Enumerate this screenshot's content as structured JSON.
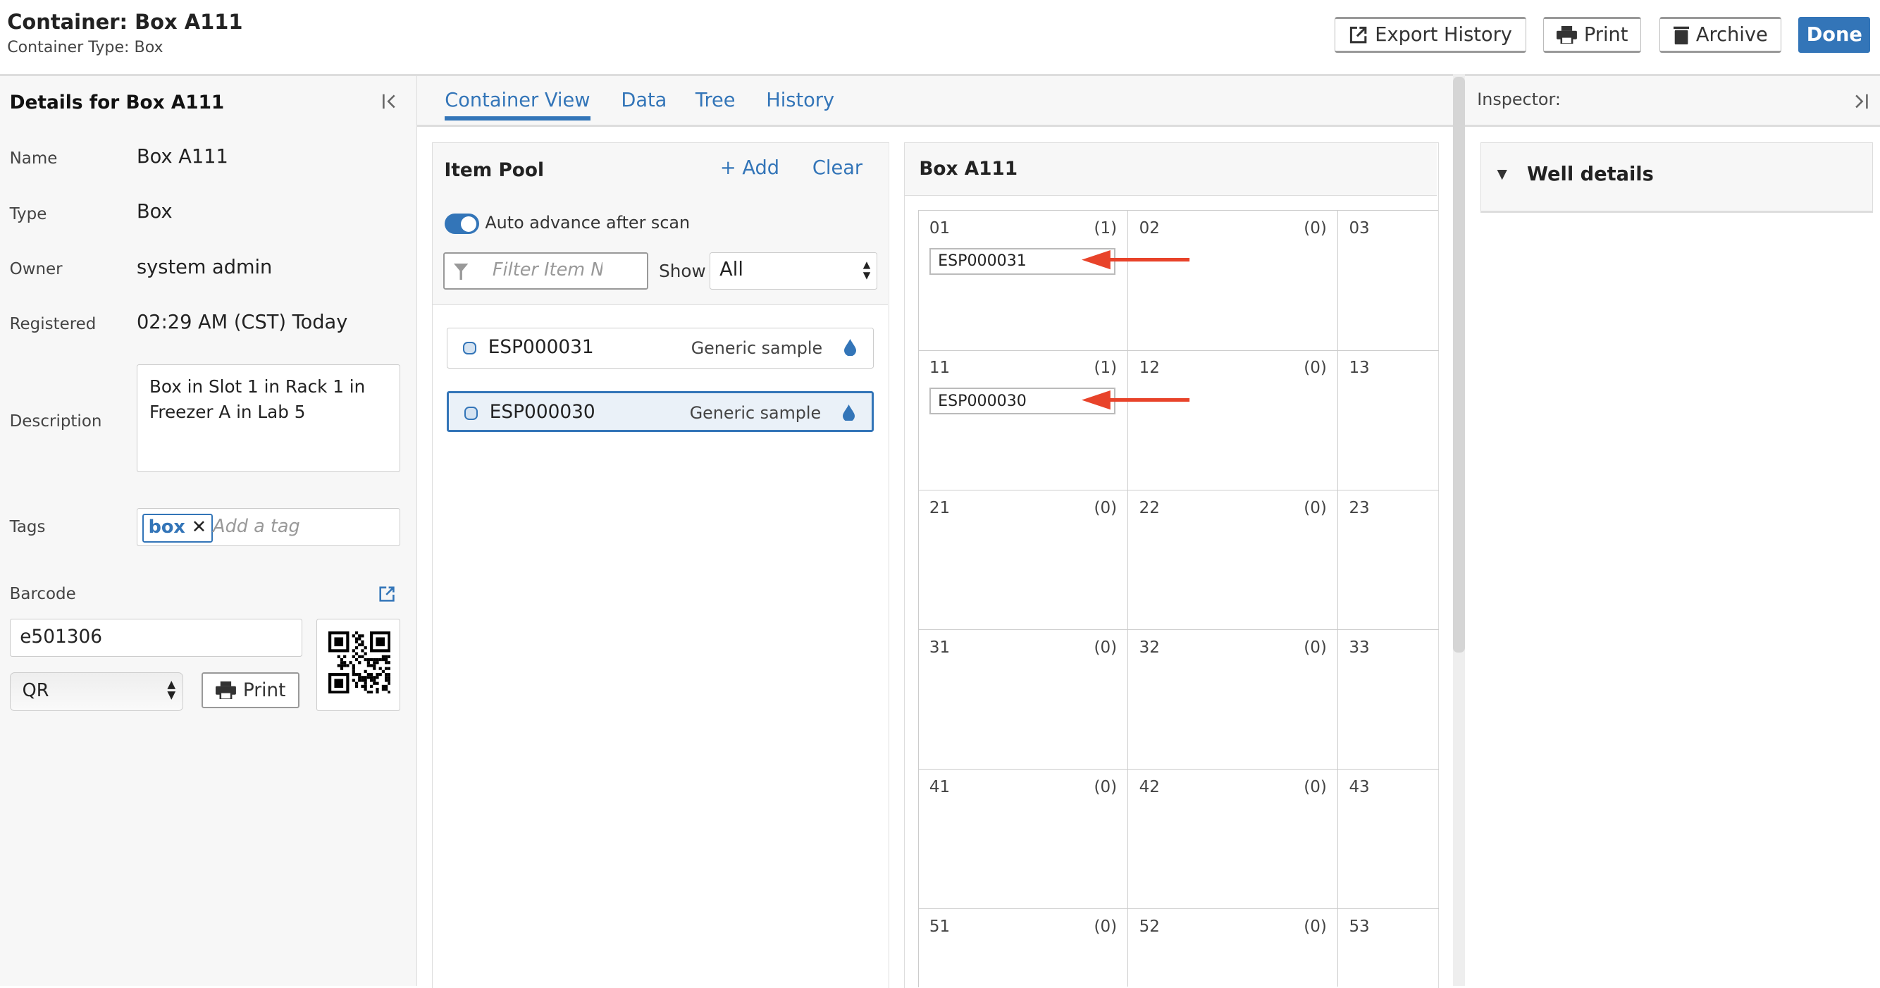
{
  "header": {
    "title": "Container: Box A111",
    "subtitle": "Container Type: Box",
    "buttons": {
      "export": "Export History",
      "print": "Print",
      "archive": "Archive",
      "done": "Done"
    }
  },
  "colors": {
    "accent": "#3375b8",
    "arrow": "#e8432a"
  },
  "details": {
    "title": "Details for Box A111",
    "fields": [
      {
        "label": "Name",
        "value": "Box A111"
      },
      {
        "label": "Type",
        "value": "Box"
      },
      {
        "label": "Owner",
        "value": "system admin"
      },
      {
        "label": "Registered",
        "value": "02:29 AM (CST) Today"
      }
    ],
    "description_label": "Description",
    "description": "Box in Slot 1 in Rack 1 in Freezer A in Lab 5",
    "tags_label": "Tags",
    "tag": "box",
    "tag_placeholder": "Add a tag",
    "barcode_label": "Barcode",
    "barcode": "e501306",
    "barcode_type": "QR",
    "print": "Print"
  },
  "tabs": [
    "Container View",
    "Data",
    "Tree",
    "History"
  ],
  "pool": {
    "title": "Item Pool",
    "add": "+ Add",
    "clear": "Clear",
    "auto_advance": "Auto advance after scan",
    "auto_advance_on": true,
    "filter_placeholder": "Filter Item Name",
    "show_label": "Show",
    "show_value": "All",
    "items": [
      {
        "id": "ESP000031",
        "type": "Generic sample",
        "selected": false
      },
      {
        "id": "ESP000030",
        "type": "Generic sample",
        "selected": true
      }
    ]
  },
  "box": {
    "title": "Box A111",
    "wells": [
      [
        {
          "label": "01",
          "count": "(1)",
          "item": "ESP000031"
        },
        {
          "label": "02",
          "count": "(0)"
        },
        {
          "label": "03"
        }
      ],
      [
        {
          "label": "11",
          "count": "(1)",
          "item": "ESP000030"
        },
        {
          "label": "12",
          "count": "(0)"
        },
        {
          "label": "13"
        }
      ],
      [
        {
          "label": "21",
          "count": "(0)"
        },
        {
          "label": "22",
          "count": "(0)"
        },
        {
          "label": "23"
        }
      ],
      [
        {
          "label": "31",
          "count": "(0)"
        },
        {
          "label": "32",
          "count": "(0)"
        },
        {
          "label": "33"
        }
      ],
      [
        {
          "label": "41",
          "count": "(0)"
        },
        {
          "label": "42",
          "count": "(0)"
        },
        {
          "label": "43"
        }
      ],
      [
        {
          "label": "51",
          "count": "(0)"
        },
        {
          "label": "52",
          "count": "(0)"
        },
        {
          "label": "53"
        }
      ]
    ]
  },
  "inspector": {
    "title": "Inspector:",
    "section": "Well details"
  }
}
